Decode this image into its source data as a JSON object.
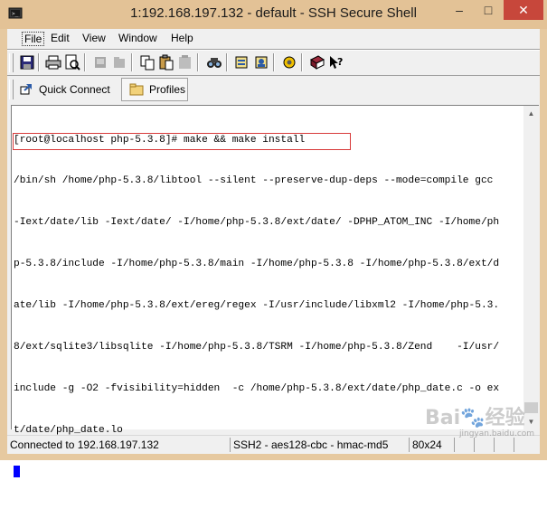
{
  "window": {
    "title": "1:192.168.197.132 - default - SSH Secure Shell",
    "minimize_glyph": "–",
    "maximize_glyph": "□",
    "close_glyph": "✕"
  },
  "menu": [
    "File",
    "Edit",
    "View",
    "Window",
    "Help"
  ],
  "quickbar": {
    "quick_connect": "Quick Connect",
    "profiles": "Profiles"
  },
  "terminal": {
    "lines": [
      "[root@localhost php-5.3.8]# make && make install",
      "/bin/sh /home/php-5.3.8/libtool --silent --preserve-dup-deps --mode=compile gcc",
      "-Iext/date/lib -Iext/date/ -I/home/php-5.3.8/ext/date/ -DPHP_ATOM_INC -I/home/ph",
      "p-5.3.8/include -I/home/php-5.3.8/main -I/home/php-5.3.8 -I/home/php-5.3.8/ext/d",
      "ate/lib -I/home/php-5.3.8/ext/ereg/regex -I/usr/include/libxml2 -I/home/php-5.3.",
      "8/ext/sqlite3/libsqlite -I/home/php-5.3.8/TSRM -I/home/php-5.3.8/Zend    -I/usr/",
      "include -g -O2 -fvisibility=hidden  -c /home/php-5.3.8/ext/date/php_date.c -o ex",
      "t/date/php_date.lo"
    ]
  },
  "status": {
    "connection": "Connected to 192.168.197.132",
    "cipher": "SSH2 - aes128-cbc - hmac-md5",
    "size": "80x24"
  },
  "watermark": {
    "brand": "Bai",
    "brand2": "经验",
    "url": "jingyan.baidu.com"
  }
}
